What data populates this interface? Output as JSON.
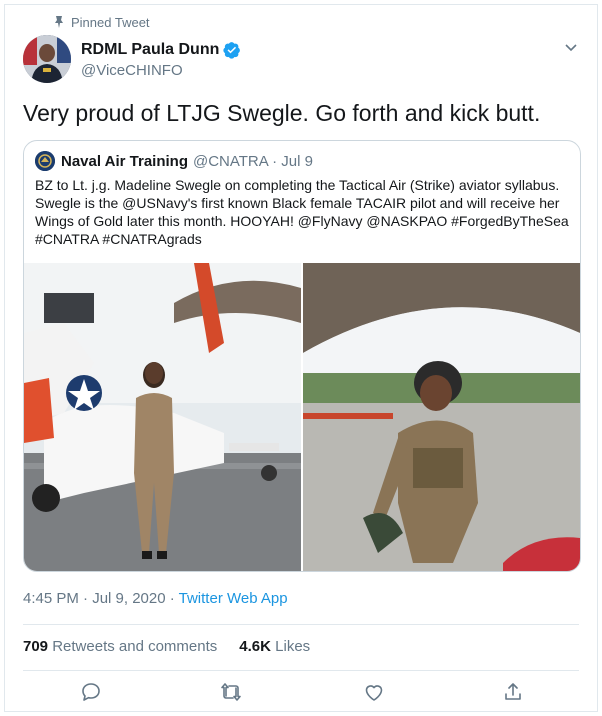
{
  "pinned_label": "Pinned Tweet",
  "author": {
    "name": "RDML Paula Dunn",
    "handle": "@ViceCHINFO"
  },
  "tweet": {
    "text": "Very proud of LTJG Swegle.  Go forth and kick butt."
  },
  "quoted": {
    "name": "Naval Air Training",
    "handle_date": "@CNATRA · Jul 9",
    "text": "BZ to Lt. j.g. Madeline Swegle on completing the Tactical Air (Strike) aviator syllabus. Swegle is the @USNavy's first known Black female TACAIR pilot and will receive her Wings of Gold later this month. HOOYAH! @FlyNavy @NASKPAO #ForgedByTheSea #CNATRA #CNATRAgrads"
  },
  "meta": {
    "timestamp": "4:45 PM · Jul 9, 2020 · ",
    "app": "Twitter Web App"
  },
  "stats": {
    "retweets_count": "709",
    "retweets_label": "Retweets and comments",
    "likes_count": "4.6K",
    "likes_label": "Likes"
  },
  "colors": {
    "link": "#1b95e0",
    "secondary_text": "#657786",
    "border": "#e1e8ed"
  },
  "icons": [
    "pin-icon",
    "verified-icon",
    "chevron-down-icon",
    "reply-icon",
    "retweet-icon",
    "like-icon",
    "share-icon"
  ]
}
